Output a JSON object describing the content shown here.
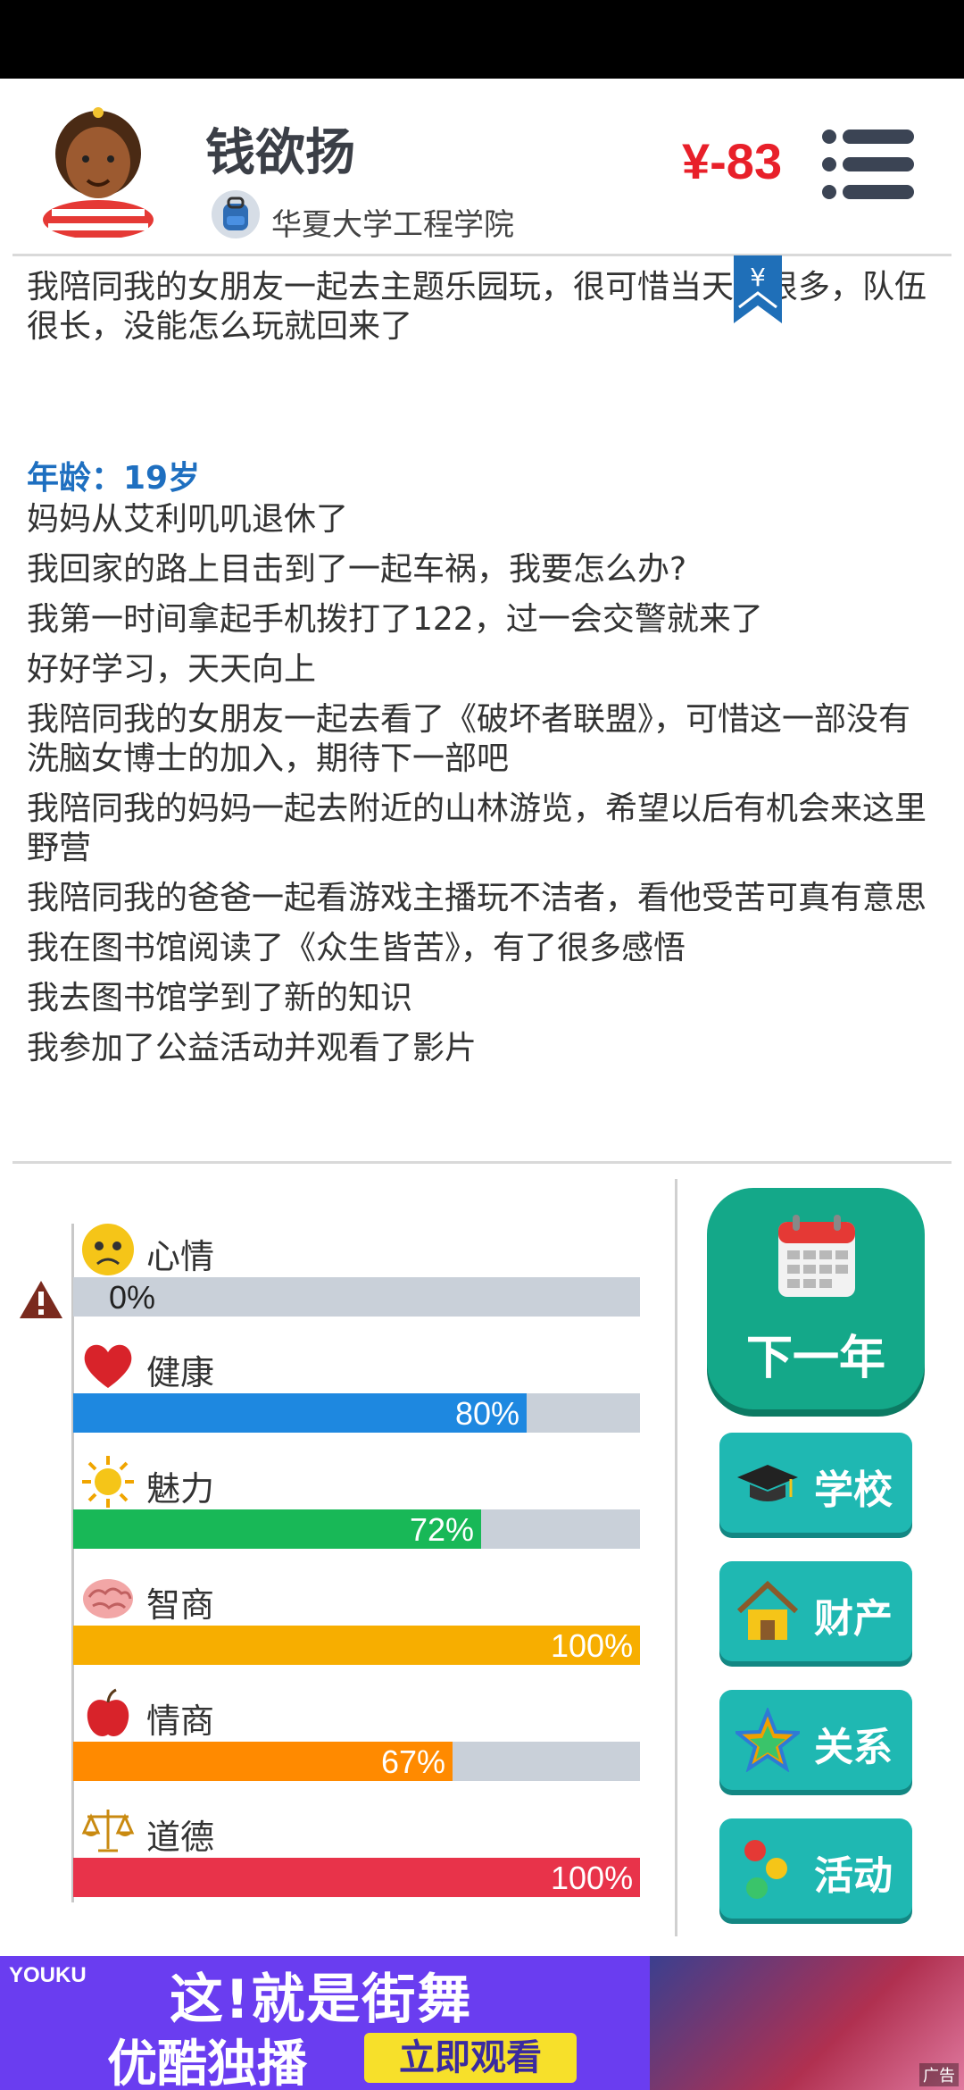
{
  "header": {
    "name": "钱欲扬",
    "school": "华夏大学工程学院",
    "money": "¥-83",
    "bookmark_symbol": "¥"
  },
  "log": {
    "top_text": "我陪同我的女朋友一起去主题乐园玩，很可惜当天人很多，队伍很长，没能怎么玩就回来了",
    "age_label": "年龄：19岁",
    "events": [
      "妈妈从艾利叽叽退休了",
      "我回家的路上目击到了一起车祸，我要怎么办?",
      "我第一时间拿起手机拨打了122，过一会交警就来了",
      "好好学习，天天向上",
      "我陪同我的女朋友一起去看了《破坏者联盟》，可惜这一部没有洗脑女博士的加入，期待下一部吧",
      "我陪同我的妈妈一起去附近的山林游览，希望以后有机会来这里野营",
      "我陪同我的爸爸一起看游戏主播玩不洁者，看他受苦可真有意思",
      "我在图书馆阅读了《众生皆苦》，有了很多感悟",
      "我去图书馆学到了新的知识",
      "我参加了公益活动并观看了影片"
    ]
  },
  "stats": [
    {
      "label": "心情",
      "value": 0,
      "pct": "0%",
      "color": "#f2c230",
      "icon": "sad-face-icon"
    },
    {
      "label": "健康",
      "value": 80,
      "pct": "80%",
      "color": "#1e88e0",
      "icon": "heart-icon"
    },
    {
      "label": "魅力",
      "value": 72,
      "pct": "72%",
      "color": "#18b857",
      "icon": "sun-icon"
    },
    {
      "label": "智商",
      "value": 100,
      "pct": "100%",
      "color": "#f7ae00",
      "icon": "brain-icon"
    },
    {
      "label": "情商",
      "value": 67,
      "pct": "67%",
      "color": "#ff8a00",
      "icon": "apple-icon"
    },
    {
      "label": "道德",
      "value": 100,
      "pct": "100%",
      "color": "#e8334a",
      "icon": "scales-icon"
    }
  ],
  "buttons": {
    "next_year": "下一年",
    "school": "学校",
    "property": "财产",
    "relations": "关系",
    "activities": "活动"
  },
  "ad": {
    "brand": "YOUKU",
    "headline": "这!就是街舞",
    "exclusive": "优酷独播",
    "cta": "立即观看",
    "tag": "广告"
  }
}
